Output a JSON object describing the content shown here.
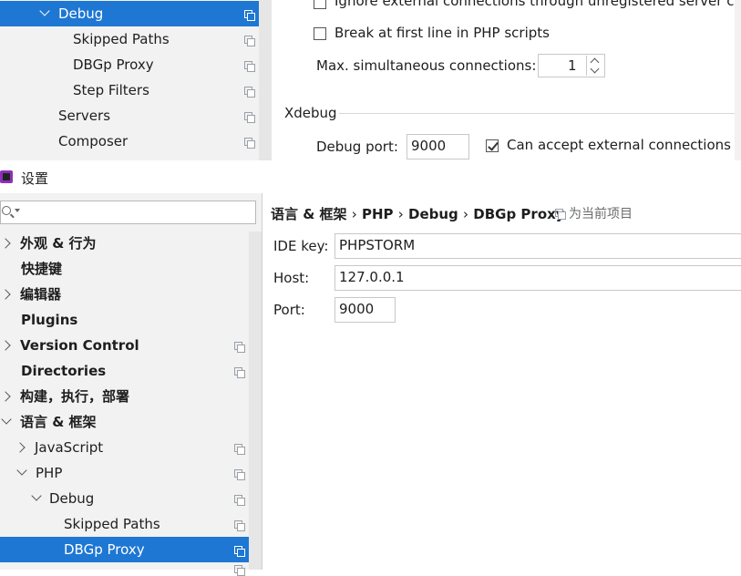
{
  "top": {
    "tree": [
      {
        "label": "Debug",
        "selected": true
      },
      {
        "label": "Skipped Paths"
      },
      {
        "label": "DBGp Proxy"
      },
      {
        "label": "Step Filters"
      },
      {
        "label": "Servers"
      },
      {
        "label": "Composer"
      }
    ],
    "ignore_external_label": "Ignore external connections through unregistered server co",
    "break_first_line_label": "Break at first line in PHP scripts",
    "max_connections_label": "Max. simultaneous connections:",
    "max_connections_value": "1",
    "xdebug_section": "Xdebug",
    "debug_port_label": "Debug port:",
    "debug_port_value": "9000",
    "accept_external_label": "Can accept external connections"
  },
  "window": {
    "title": "设置"
  },
  "search": {
    "placeholder": ""
  },
  "breadcrumb": {
    "part1": "语言 & 框架",
    "sep": "›",
    "part2": "PHP",
    "part3": "Debug",
    "part4": "DBGp Proxy",
    "scope": "为当前项目"
  },
  "form": {
    "ide_key_label": "IDE key:",
    "ide_key_value": "PHPSTORM",
    "host_label": "Host:",
    "host_value": "127.0.0.1",
    "port_label": "Port:",
    "port_value": "9000"
  },
  "tree": {
    "items": [
      {
        "label": "外观 & 行为"
      },
      {
        "label": "快捷键"
      },
      {
        "label": "编辑器"
      },
      {
        "label": "Plugins"
      },
      {
        "label": "Version Control"
      },
      {
        "label": "Directories"
      },
      {
        "label": "构建，执行，部署"
      },
      {
        "label": "语言 & 框架"
      },
      {
        "label": "JavaScript"
      },
      {
        "label": "PHP"
      },
      {
        "label": "Debug"
      },
      {
        "label": "Skipped Paths"
      },
      {
        "label": "DBGp Proxy",
        "selected": true
      }
    ]
  },
  "colors": {
    "selection": "#1e77d3",
    "sidebar_bg": "#f2f2f2"
  }
}
